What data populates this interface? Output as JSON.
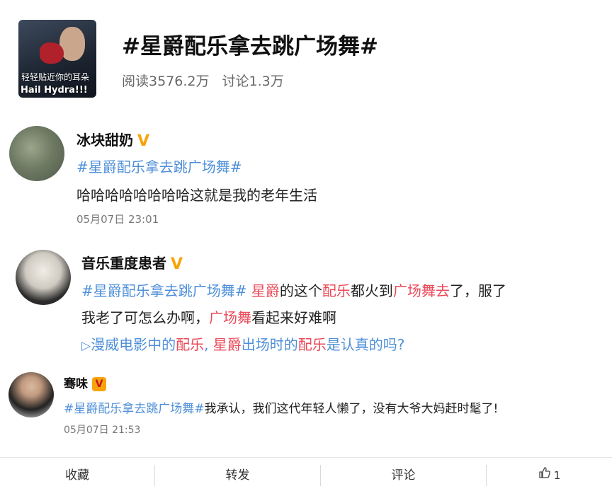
{
  "topic": {
    "title": "#星爵配乐拿去跳广场舞#",
    "thumb_caption_1": "轻轻贴近你的耳朵",
    "thumb_caption_2": "Hail Hydra!!!",
    "read_count": "阅读3576.2万",
    "discuss_count": "讨论1.3万"
  },
  "comments": [
    {
      "user": "冰块甜奶",
      "hashtag": "#星爵配乐拿去跳广场舞#",
      "text": "哈哈哈哈哈哈哈哈这就是我的老年生活",
      "time": "05月07日 23:01"
    },
    {
      "user": "音乐重度患者",
      "hashtag": "#星爵配乐拿去跳广场舞#",
      "line1": [
        " ",
        "星爵",
        "的这个",
        "配乐",
        "都火到",
        "广场舞去",
        "了，服了"
      ],
      "line2": [
        "我老了可怎么办啊，",
        "广场舞",
        "看起来好难啊"
      ],
      "video_icon": "video-icon",
      "video_link": [
        "漫威电影中的",
        "配乐",
        ", ",
        "星爵",
        "出场时的",
        "配乐",
        "是认真的吗?"
      ]
    },
    {
      "user": "骞味",
      "hashtag": "#星爵配乐拿去跳广场舞#",
      "text": "我承认，我们这代年轻人懒了，没有大爷大妈赶时髦了!",
      "time": "05月07日 21:53"
    }
  ],
  "actions": {
    "favorite": "收藏",
    "repost": "转发",
    "comment": "评论",
    "like_icon": "thumbs-up-icon",
    "like_count": "1"
  },
  "colors": {
    "hashtag": "#e94a59",
    "link": "#4e8fd8",
    "verified": "#f7a40a"
  }
}
